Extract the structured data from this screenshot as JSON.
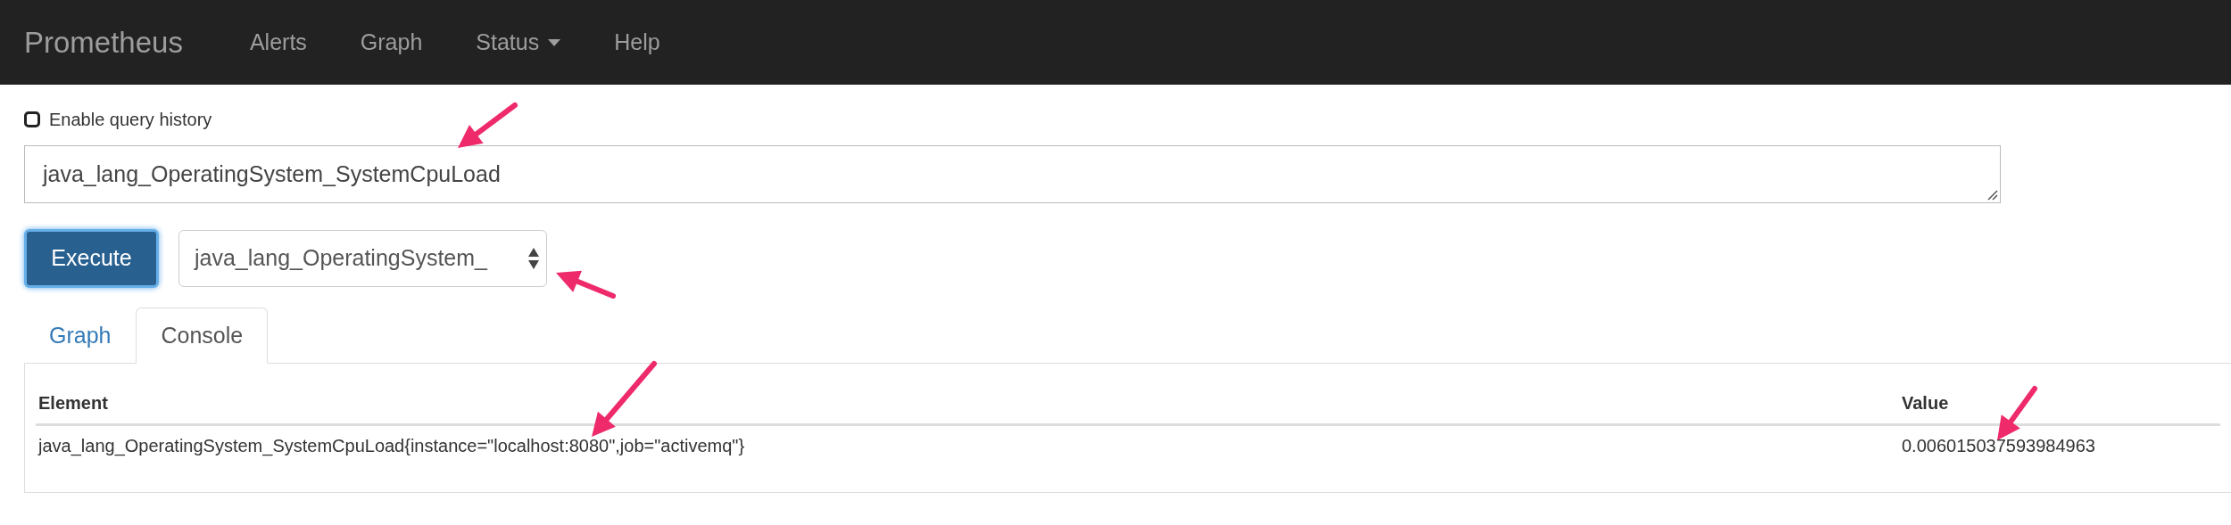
{
  "navbar": {
    "brand": "Prometheus",
    "items": [
      {
        "label": "Alerts",
        "dropdown": false
      },
      {
        "label": "Graph",
        "dropdown": false
      },
      {
        "label": "Status",
        "dropdown": true
      },
      {
        "label": "Help",
        "dropdown": false
      }
    ]
  },
  "history": {
    "label": "Enable query history",
    "checked": false
  },
  "query": {
    "value": "java_lang_OperatingSystem_SystemCpuLoad"
  },
  "execute": {
    "label": "Execute"
  },
  "metric_select": {
    "value": "java_lang_OperatingSystem_"
  },
  "tabs": [
    {
      "label": "Graph",
      "selected": false
    },
    {
      "label": "Console",
      "selected": true
    }
  ],
  "table": {
    "columns": [
      "Element",
      "Value"
    ],
    "rows": [
      {
        "element": "java_lang_OperatingSystem_SystemCpuLoad{instance=\"localhost:8080\",job=\"activemq\"}",
        "value": "0.006015037593984963"
      }
    ]
  },
  "annotations": [
    {
      "kind": "arrow",
      "color": "#ee2a6b"
    },
    {
      "kind": "arrow",
      "color": "#ee2a6b"
    },
    {
      "kind": "arrow",
      "color": "#ee2a6b"
    },
    {
      "kind": "arrow",
      "color": "#ee2a6b"
    }
  ]
}
